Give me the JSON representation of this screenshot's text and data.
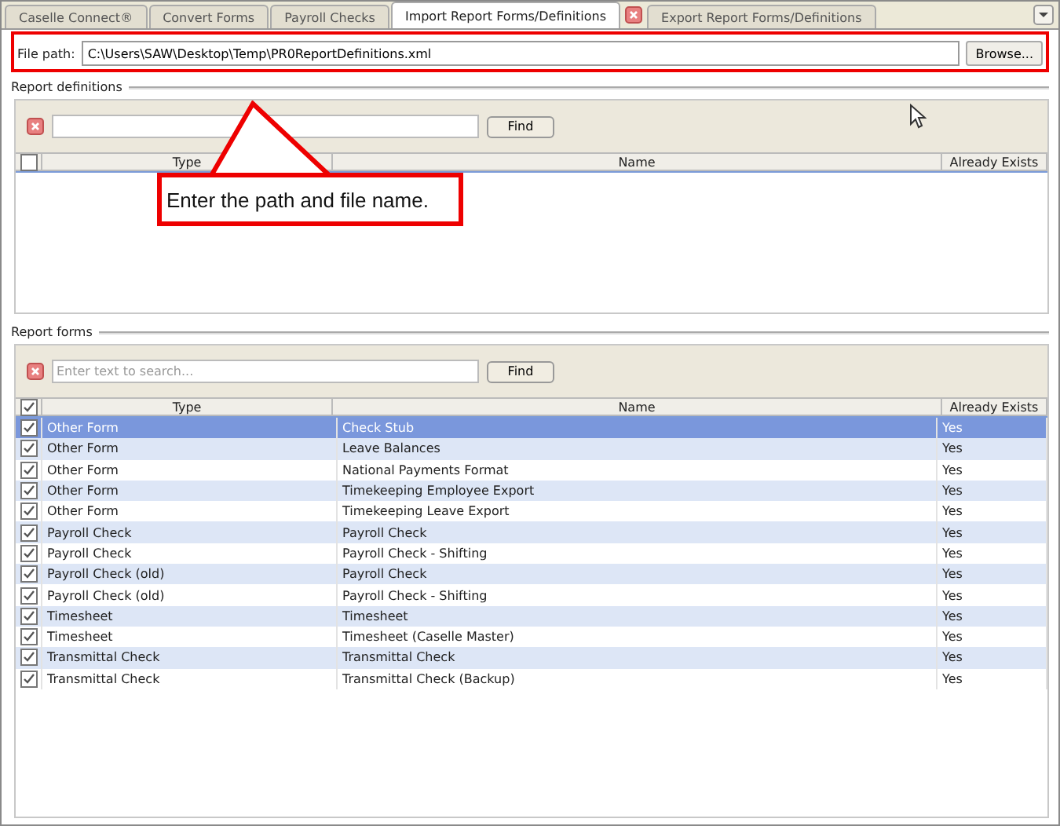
{
  "tabs": [
    {
      "label": "Caselle Connect®",
      "selected": false,
      "closable": false
    },
    {
      "label": "Convert Forms",
      "selected": false,
      "closable": false
    },
    {
      "label": "Payroll Checks",
      "selected": false,
      "closable": false
    },
    {
      "label": "Import Report Forms/Definitions",
      "selected": true,
      "closable": true
    },
    {
      "label": "Export Report Forms/Definitions",
      "selected": false,
      "closable": false
    }
  ],
  "file_path": {
    "label": "File path:",
    "value": "C:\\Users\\SAW\\Desktop\\Temp\\PR0ReportDefinitions.xml",
    "button": "Browse..."
  },
  "callout": {
    "text": "Enter the path and file name."
  },
  "report_definitions": {
    "title": "Report definitions",
    "find": "Find",
    "all_checked": false,
    "columns": [
      "Type",
      "Name",
      "Already Exists"
    ]
  },
  "report_forms": {
    "title": "Report forms",
    "search": {
      "placeholder": "Enter text to search..."
    },
    "find": "Find",
    "all_checked": true,
    "columns": [
      "Type",
      "Name",
      "Already Exists"
    ],
    "rows": [
      {
        "type": "Other Form",
        "name": "Check Stub",
        "exists": "Yes",
        "checked": true,
        "selected": true
      },
      {
        "type": "Other Form",
        "name": "Leave Balances",
        "exists": "Yes",
        "checked": true,
        "selected": false
      },
      {
        "type": "Other Form",
        "name": "National Payments Format",
        "exists": "Yes",
        "checked": true,
        "selected": false
      },
      {
        "type": "Other Form",
        "name": "Timekeeping Employee Export",
        "exists": "Yes",
        "checked": true,
        "selected": false
      },
      {
        "type": "Other Form",
        "name": "Timekeeping Leave Export",
        "exists": "Yes",
        "checked": true,
        "selected": false
      },
      {
        "type": "Payroll Check",
        "name": "Payroll Check",
        "exists": "Yes",
        "checked": true,
        "selected": false
      },
      {
        "type": "Payroll Check",
        "name": "Payroll Check - Shifting",
        "exists": "Yes",
        "checked": true,
        "selected": false
      },
      {
        "type": "Payroll Check (old)",
        "name": "Payroll Check",
        "exists": "Yes",
        "checked": true,
        "selected": false
      },
      {
        "type": "Payroll Check (old)",
        "name": "Payroll Check - Shifting",
        "exists": "Yes",
        "checked": true,
        "selected": false
      },
      {
        "type": "Timesheet",
        "name": "Timesheet",
        "exists": "Yes",
        "checked": true,
        "selected": false
      },
      {
        "type": "Timesheet",
        "name": "Timesheet (Caselle Master)",
        "exists": "Yes",
        "checked": true,
        "selected": false
      },
      {
        "type": "Transmittal Check",
        "name": "Transmittal Check",
        "exists": "Yes",
        "checked": true,
        "selected": false
      },
      {
        "type": "Transmittal Check",
        "name": "Transmittal Check (Backup)",
        "exists": "Yes",
        "checked": true,
        "selected": false
      }
    ]
  }
}
